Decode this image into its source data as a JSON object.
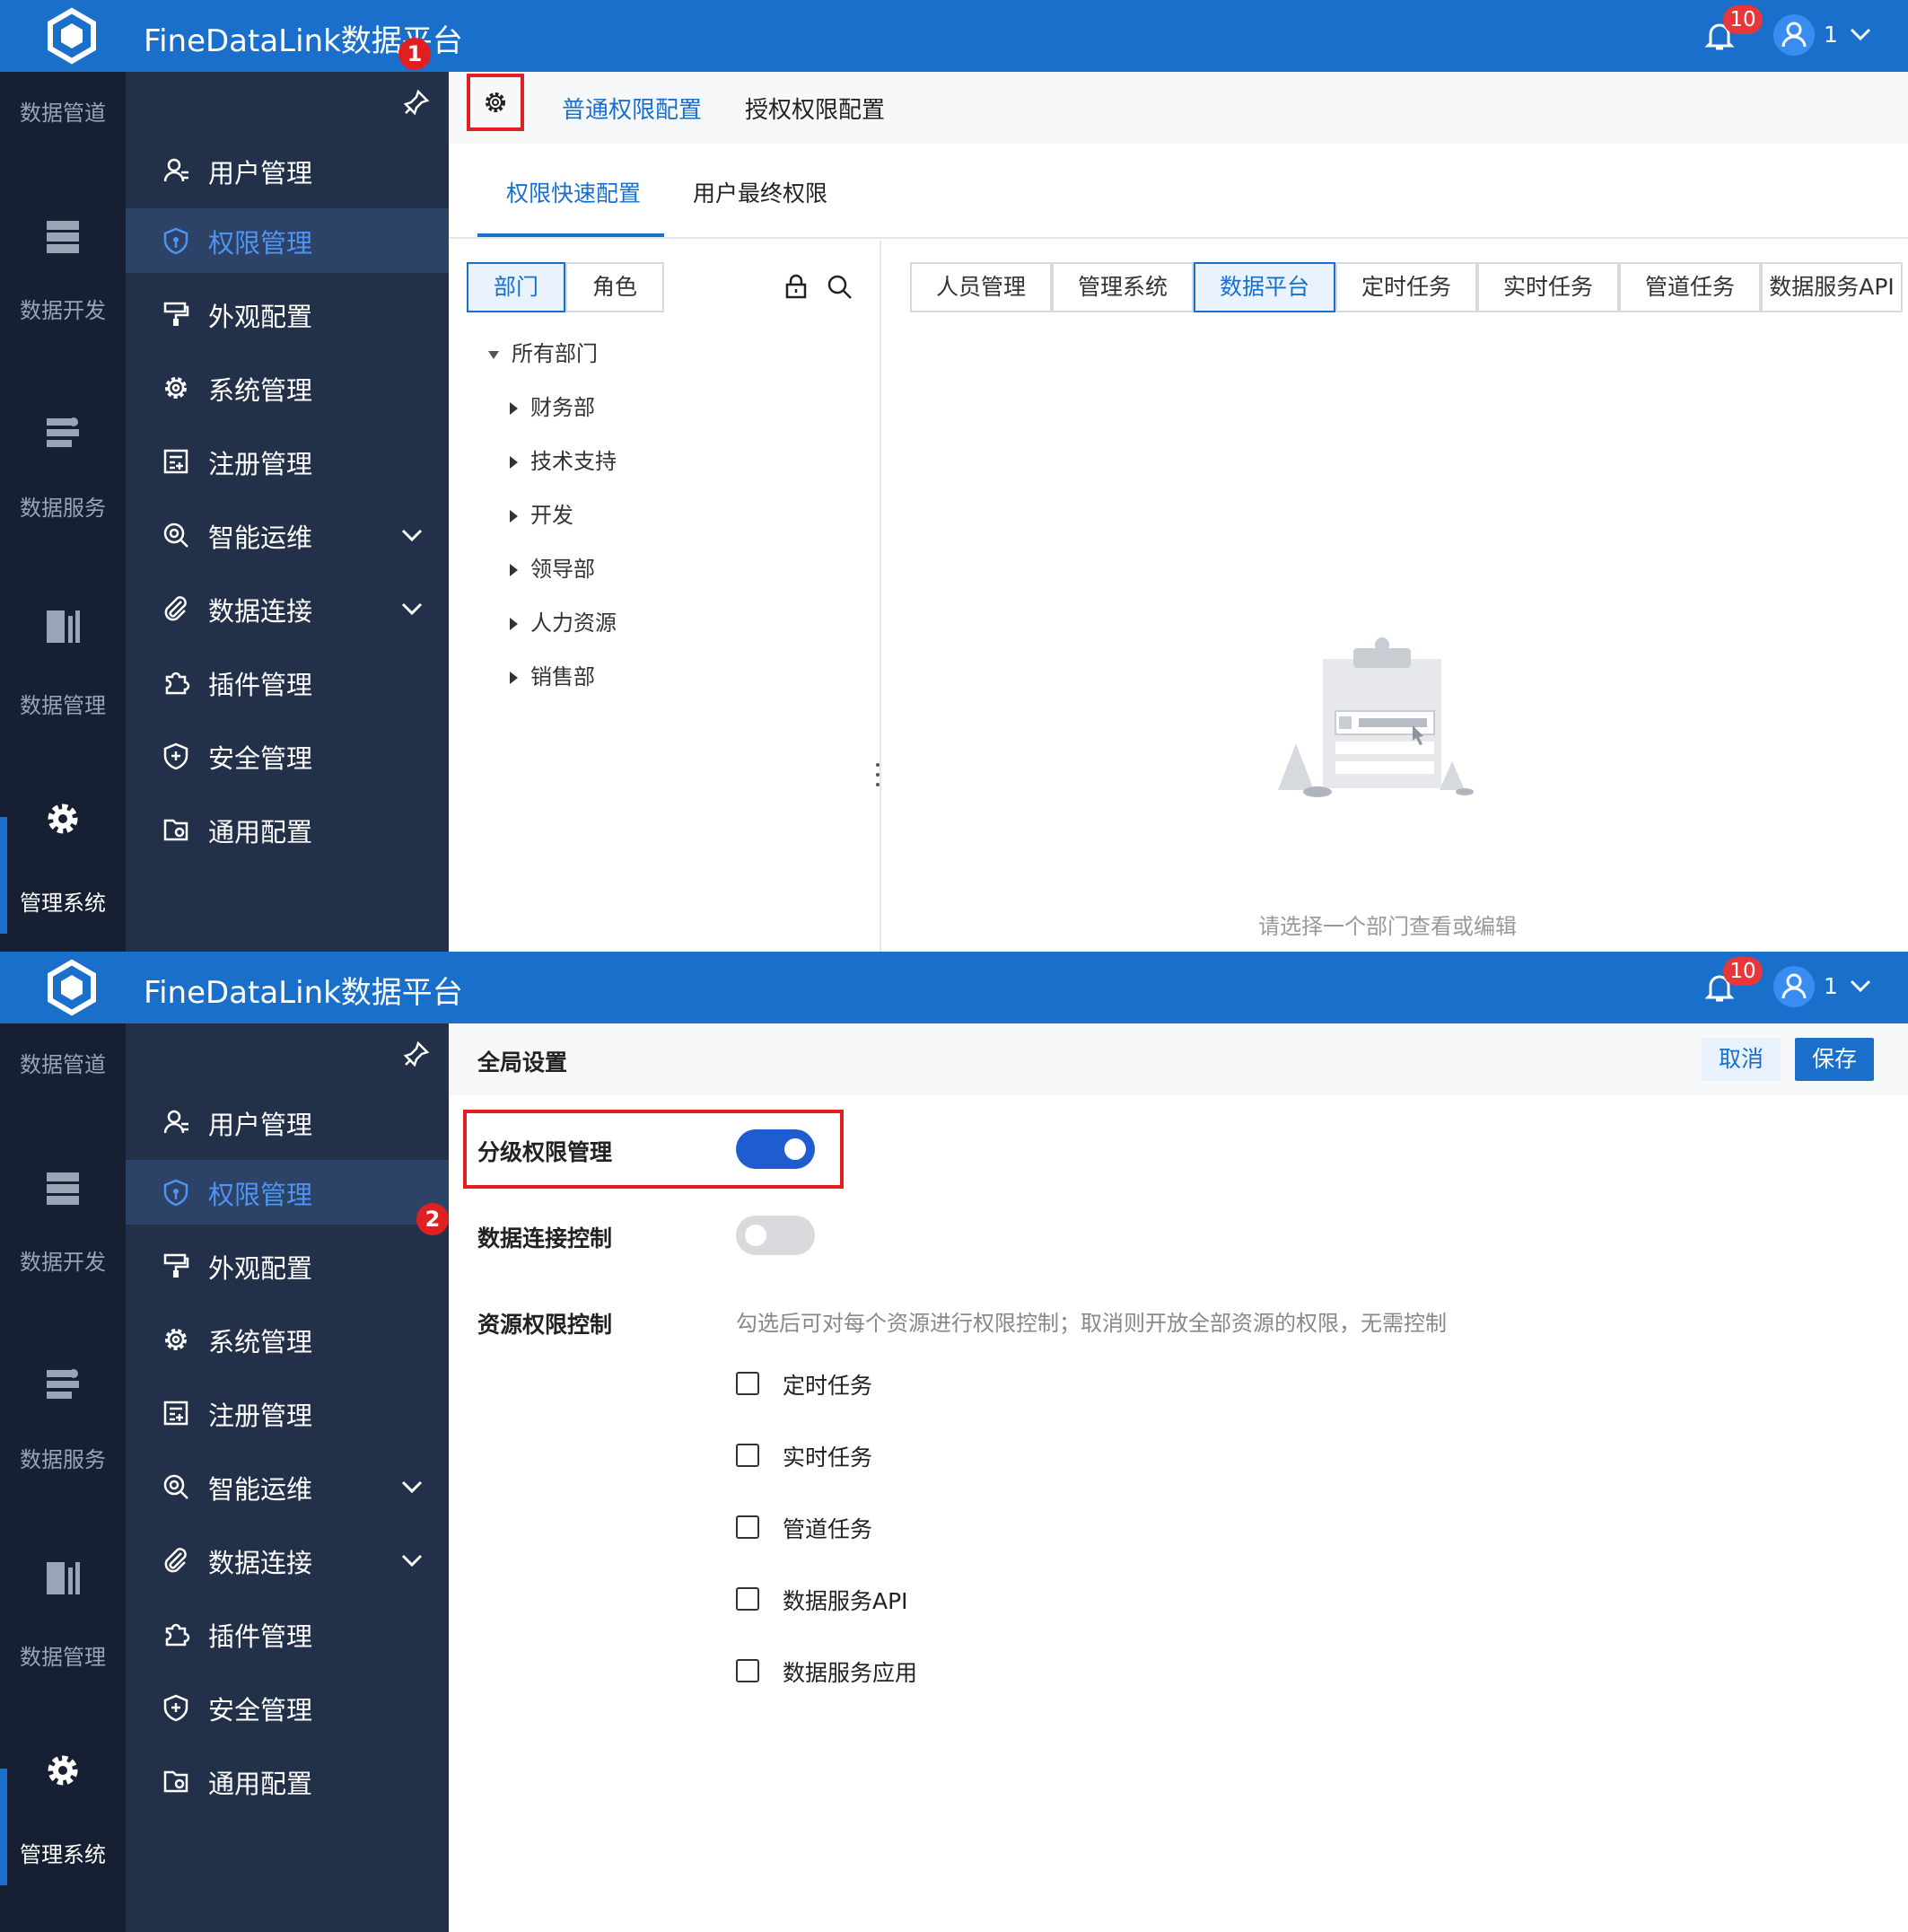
{
  "app": {
    "title": "FineDataLink数据平台",
    "notifications": "10",
    "user": "1"
  },
  "rail": [
    "数据管道",
    "数据开发",
    "数据服务",
    "数据管理",
    "管理系统"
  ],
  "menu": [
    "用户管理",
    "权限管理",
    "外观配置",
    "系统管理",
    "注册管理",
    "智能运维",
    "数据连接",
    "插件管理",
    "安全管理",
    "通用配置"
  ],
  "panel1": {
    "top_tabs": [
      "普通权限配置",
      "授权权限配置"
    ],
    "sub_tabs": [
      "权限快速配置",
      "用户最终权限"
    ],
    "segments": [
      "部门",
      "角色"
    ],
    "tree_root": "所有部门",
    "tree": [
      "财务部",
      "技术支持",
      "开发",
      "领导部",
      "人力资源",
      "销售部"
    ],
    "module_tabs": [
      "人员管理",
      "管理系统",
      "数据平台",
      "定时任务",
      "实时任务",
      "管道任务",
      "数据服务API"
    ],
    "empty_text": "请选择一个部门查看或编辑",
    "marker": "1"
  },
  "panel2": {
    "title": "全局设置",
    "cancel": "取消",
    "save": "保存",
    "marker": "2",
    "fields": {
      "hierarchy": {
        "label": "分级权限管理",
        "on": true
      },
      "connection": {
        "label": "数据连接控制",
        "on": false
      },
      "resource": {
        "label": "资源权限控制",
        "hint": "勾选后可对每个资源进行权限控制；取消则开放全部资源的权限，无需控制"
      }
    },
    "resources": [
      "定时任务",
      "实时任务",
      "管道任务",
      "数据服务API",
      "数据服务应用"
    ]
  },
  "colors": {
    "brand": "#1a6fcb",
    "rail": "#162032",
    "menu": "#233049",
    "marker": "#e02020"
  }
}
